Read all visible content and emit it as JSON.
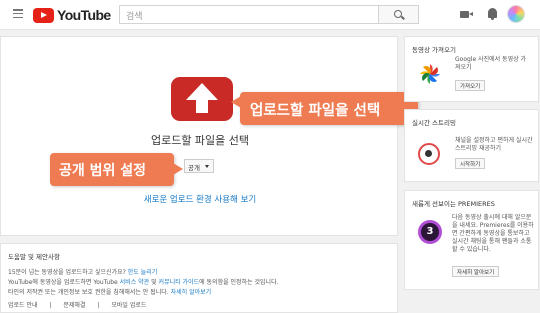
{
  "header": {
    "logo_text": "YouTube",
    "search_placeholder": "검색"
  },
  "upload": {
    "title": "업로드할 파일을 선택",
    "privacy_value": "공개",
    "new_experience_link": "새로운 업로드 환경 사용해 보기"
  },
  "callouts": {
    "upload": "업로드할 파일을 선택",
    "privacy": "공개 범위 설정"
  },
  "help": {
    "title": "도움말 및 제안사항",
    "line1_text": "15분이 넘는 동영상을 업로드하고 싶으신가요?",
    "line1_link": "한도 늘리기",
    "line2_text_a": "YouTube에 동영상을 업로드하면 YouTube",
    "line2_link_a": "서비스 약관",
    "line2_text_b": "및",
    "line2_link_b": "커뮤니티 가이드",
    "line2_text_c": "에 동의함을 인정하는 것입니다.",
    "line3_text": "타인의 저작권 또는 개인정보 보호 권한을 침해해서는 안 됩니다.",
    "line3_link": "자세히 알아보기",
    "links": [
      "업로드 안내",
      "문제해결",
      "모바일 업로드"
    ]
  },
  "sidebar": {
    "import": {
      "title": "동영상 가져오기",
      "text": "Google 사진에서 동영상 가져오기",
      "button": "가져오기"
    },
    "live": {
      "title": "실시간 스트리밍",
      "text": "채널을 설정하고 편하게 실시간 스트리밍 재공하기",
      "button": "시작하기"
    },
    "premieres": {
      "title": "새롭게 선보이는 PREMIERES",
      "text": "다음 동영상 출시에 대해 알으문을 내세요. Premieres를 이용하면 간편하게 동영상을 통보하고 실시간 채팅을 통해 팬들과 소통할 수 있습니다.",
      "button": "자세히 알아보기",
      "badge": "3"
    }
  },
  "colors": {
    "brand_red": "#e62117",
    "upload_red": "#c92a26",
    "callout_orange": "#ee7b52",
    "link_blue": "#167ac6"
  }
}
